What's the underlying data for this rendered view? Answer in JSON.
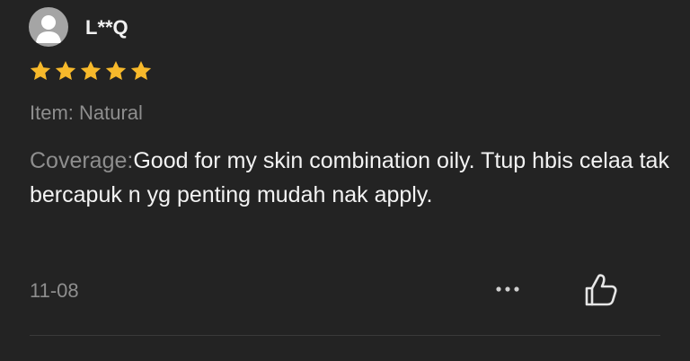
{
  "review": {
    "username": "L**Q",
    "rating": 5,
    "rating_max": 5,
    "item_label": "Item: Natural",
    "coverage_label": "Coverage:",
    "text": "Good for my skin combination oily. Ttup hbis celaa tak bercapuk n yg penting mudah nak apply.",
    "date": "11-08"
  },
  "icons": {
    "avatar": "user-silhouette-icon",
    "star": "star-icon",
    "more": "more-horizontal-icon",
    "like": "thumbs-up-icon"
  },
  "colors": {
    "background": "#232323",
    "star": "#f7b92b",
    "primary_text": "#f3f3f3",
    "secondary_text": "#8e8e8e"
  }
}
